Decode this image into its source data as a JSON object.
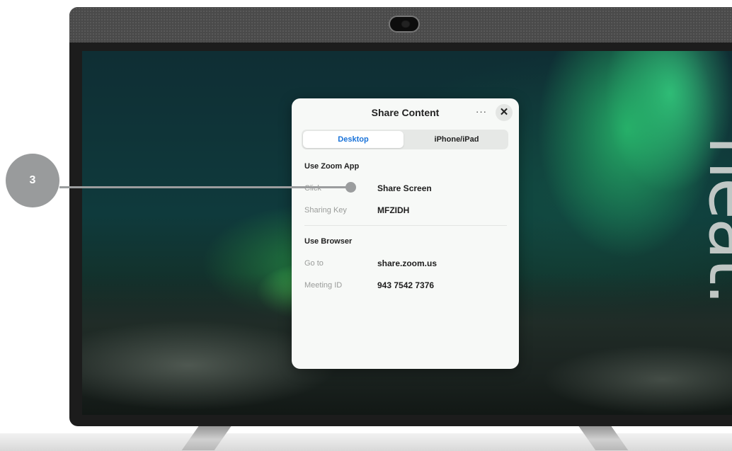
{
  "annotation": {
    "step_number": "3"
  },
  "device": {
    "brand_logo": "neat."
  },
  "dialog": {
    "title": "Share Content",
    "more_label": "···",
    "close_label": "✕",
    "tabs": [
      {
        "label": "Desktop",
        "selected": true
      },
      {
        "label": "iPhone/iPad",
        "selected": false
      }
    ],
    "zoom_app": {
      "heading": "Use Zoom App",
      "rows": [
        {
          "label": "Click",
          "value": "Share Screen"
        },
        {
          "label": "Sharing Key",
          "value": "MFZIDH"
        }
      ]
    },
    "browser": {
      "heading": "Use Browser",
      "rows": [
        {
          "label": "Go to",
          "value": "share.zoom.us"
        },
        {
          "label": "Meeting ID",
          "value": "943 7542 7376"
        }
      ]
    }
  },
  "colors": {
    "selected_tab_text": "#1a73d9",
    "callout": "#999b9c"
  }
}
